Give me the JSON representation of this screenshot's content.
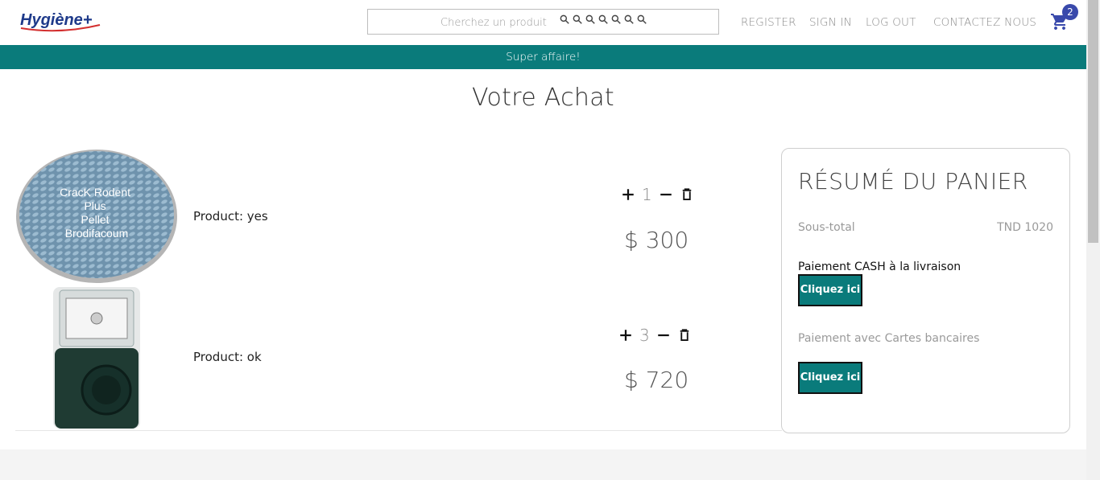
{
  "header": {
    "logo_text": "Hygiène+",
    "search": {
      "placeholder": "Cherchez un produit"
    },
    "nav": [
      "REGISTER",
      "SIGN IN",
      "LOG OUT",
      "CONTACTEZ NOUS"
    ],
    "cart": {
      "icon": "cart-icon",
      "count": "2"
    }
  },
  "banner": {
    "text": "Super affaire!"
  },
  "page": {
    "title": "Votre Achat"
  },
  "products": [
    {
      "label": "Product: yes",
      "image_text": "CracK Rodent Plus Pellet Brodifacoum",
      "quantity": "1",
      "price": "$ 300"
    },
    {
      "label": "Product: ok",
      "quantity": "3",
      "price": "$ 720"
    }
  ],
  "summary": {
    "title": "RÉSUMÉ DU PANIER",
    "subtotal_label": "Sous-total",
    "subtotal_value": "TND 1020",
    "cash_label": "Paiement CASH à la livraison",
    "cash_button": "Cliquez ici",
    "card_label": "Paiement avec Cartes bancaires",
    "card_button": "Cliquez ici"
  },
  "colors": {
    "accent": "#0a7b7b",
    "badge": "#3949ab",
    "logo_blue": "#1e3a8a",
    "logo_red": "#d32f2f"
  }
}
